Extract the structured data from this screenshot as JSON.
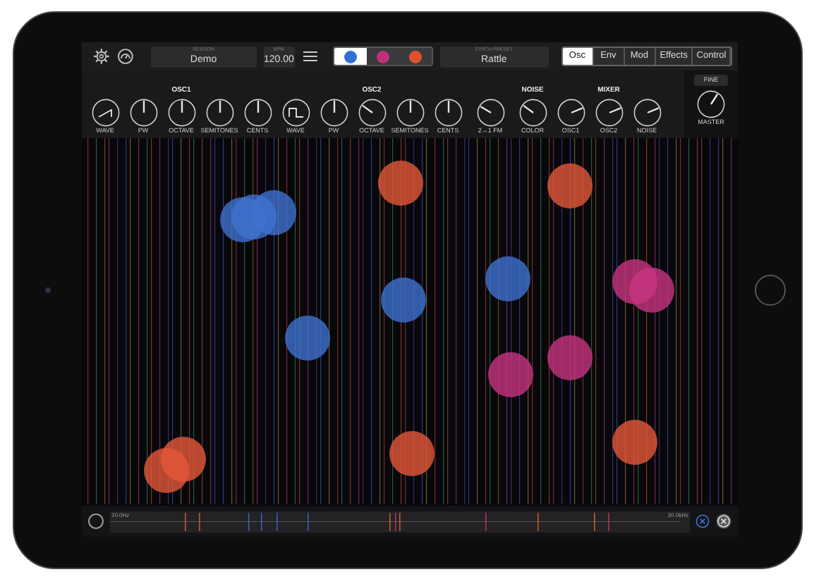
{
  "toolbar": {
    "session": {
      "label": "SESSION",
      "value": "Demo"
    },
    "bpm": {
      "label": "BPM",
      "value": "120.00"
    },
    "voices": [
      {
        "color": "#2f6fd6",
        "selected": true
      },
      {
        "color": "#c0307a",
        "selected": false
      },
      {
        "color": "#e0502e",
        "selected": false
      }
    ],
    "preset": {
      "label": "SYNTH PRESET",
      "value": "Rattle"
    },
    "tabs": [
      {
        "label": "Osc",
        "selected": true
      },
      {
        "label": "Env",
        "selected": false
      },
      {
        "label": "Mod",
        "selected": false
      },
      {
        "label": "Effects",
        "selected": false
      },
      {
        "label": "Control",
        "selected": false
      }
    ]
  },
  "groups": [
    {
      "title": "OSC1",
      "knobs": [
        {
          "label": "WAVE",
          "kind": "saw"
        },
        {
          "label": "PW",
          "kind": "dial",
          "level": 0.5
        },
        {
          "label": "OCTAVE",
          "kind": "dial",
          "level": 0.5
        },
        {
          "label": "SEMITONES",
          "kind": "dial",
          "level": 0.5
        },
        {
          "label": "CENTS",
          "kind": "dial",
          "level": 0.5
        }
      ]
    },
    {
      "title": "OSC2",
      "knobs": [
        {
          "label": "WAVE",
          "kind": "square"
        },
        {
          "label": "PW",
          "kind": "dial",
          "level": 0.5
        },
        {
          "label": "OCTAVE",
          "kind": "dial",
          "level": 0.3
        },
        {
          "label": "SEMITONES",
          "kind": "dial",
          "level": 0.5
        },
        {
          "label": "CENTS",
          "kind": "dial",
          "level": 0.5
        }
      ]
    },
    {
      "knobs": [
        {
          "label": "2→1 FM",
          "kind": "dial",
          "level": 0.28
        }
      ]
    },
    {
      "title": "NOISE",
      "knobs": [
        {
          "label": "COLOR",
          "kind": "dial",
          "level": 0.3
        }
      ]
    },
    {
      "title": "MIXER",
      "knobs": [
        {
          "label": "OSC1",
          "kind": "dial",
          "level": 0.75
        },
        {
          "label": "OSC2",
          "kind": "dial",
          "level": 0.75
        },
        {
          "label": "NOISE",
          "kind": "dial",
          "level": 0.75
        }
      ]
    }
  ],
  "master": {
    "button": "FINE",
    "knob": {
      "label": "MASTER",
      "kind": "dial",
      "level": 0.62
    }
  },
  "bottom_bar": {
    "range_start": "20.0Hz",
    "range_end": "20.0kHz"
  }
}
